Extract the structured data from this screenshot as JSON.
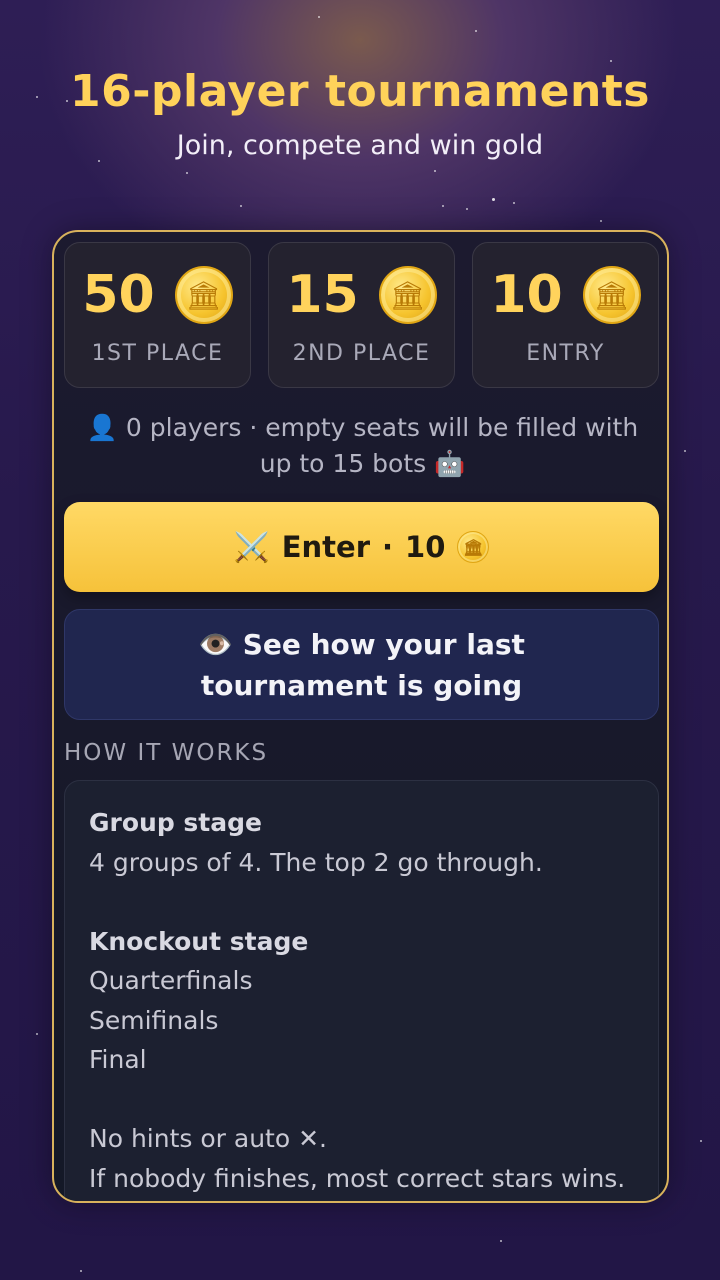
{
  "hero": {
    "title": "16-player tournaments",
    "subtitle": "Join, compete and win gold"
  },
  "prizes": [
    {
      "amount": "50",
      "label": "1ST PLACE",
      "icon": "gold-coin-icon"
    },
    {
      "amount": "15",
      "label": "2ND PLACE",
      "icon": "gold-coin-icon"
    },
    {
      "amount": "10",
      "label": "ENTRY",
      "icon": "gold-coin-icon"
    }
  ],
  "players_info": {
    "icon": "👤",
    "text": "0 players · empty seats will be filled with up to 15 bots",
    "bot_icon": "🤖"
  },
  "enter_button": {
    "icon": "⚔️",
    "label": "Enter",
    "separator": "·",
    "cost": "10"
  },
  "last_tournament_button": {
    "icon": "👁️",
    "label": "See how your last tournament is going"
  },
  "how_it_works": {
    "title": "HOW IT WORKS",
    "group_stage_heading": "Group stage",
    "group_stage_text": "4 groups of 4. The top 2 go through.",
    "knockout_heading": "Knockout stage",
    "knockout_rounds": [
      "Quarterfinals",
      "Semifinals",
      "Final"
    ],
    "rule_1": "No hints or auto ✕.",
    "rule_2": "If nobody finishes, most correct stars wins."
  },
  "colors": {
    "gold_accent": "#ffd25a",
    "panel_border": "#d8b25c",
    "enter_button": "#f6c23a",
    "last_button": "#20264f"
  }
}
